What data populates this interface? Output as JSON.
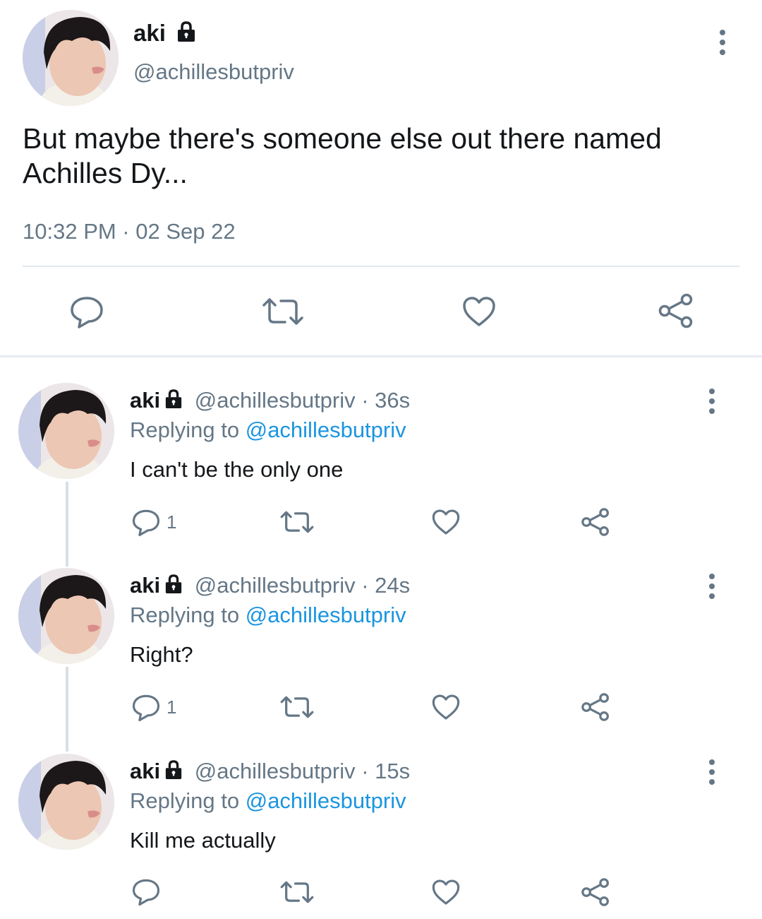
{
  "main_tweet": {
    "display_name": "aki",
    "handle": "@achillesbutpriv",
    "text_line1": "But maybe there's someone else out there named",
    "text_line2": "Achilles Dy...",
    "timestamp": "10:32 PM · 02 Sep 22"
  },
  "replies": [
    {
      "name": "aki",
      "handle_time": "@achillesbutpriv · 36s",
      "replying_prefix": "Replying to",
      "replying_handle": "@achillesbutpriv",
      "text": "I can't be the only one",
      "reply_count": "1"
    },
    {
      "name": "aki",
      "handle_time": "@achillesbutpriv · 24s",
      "replying_prefix": "Replying to",
      "replying_handle": "@achillesbutpriv",
      "text": "Right?",
      "reply_count": "1"
    },
    {
      "name": "aki",
      "handle_time": "@achillesbutpriv · 15s",
      "replying_prefix": "Replying to",
      "replying_handle": "@achillesbutpriv",
      "text": "Kill me actually",
      "reply_count": ""
    }
  ],
  "icons": [
    "reply-icon",
    "retweet-icon",
    "like-icon",
    "share-icon",
    "more-options-icon",
    "lock-icon"
  ],
  "colors": {
    "text": "#14171a",
    "secondary": "#657786",
    "link": "#1b95e0",
    "divider": "#e1e8ed"
  }
}
